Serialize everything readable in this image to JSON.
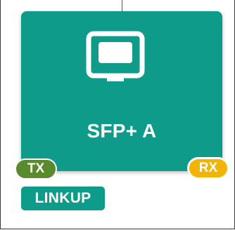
{
  "port": {
    "name": "SFP+ A",
    "icon": "monitor-icon",
    "color": "#0f9b8a"
  },
  "badges": {
    "tx_label": "TX",
    "tx_color": "#5a8a2e",
    "rx_label": "RX",
    "rx_color": "#f2b400"
  },
  "status": {
    "label": "LINKUP",
    "color": "#0f9b8a"
  }
}
